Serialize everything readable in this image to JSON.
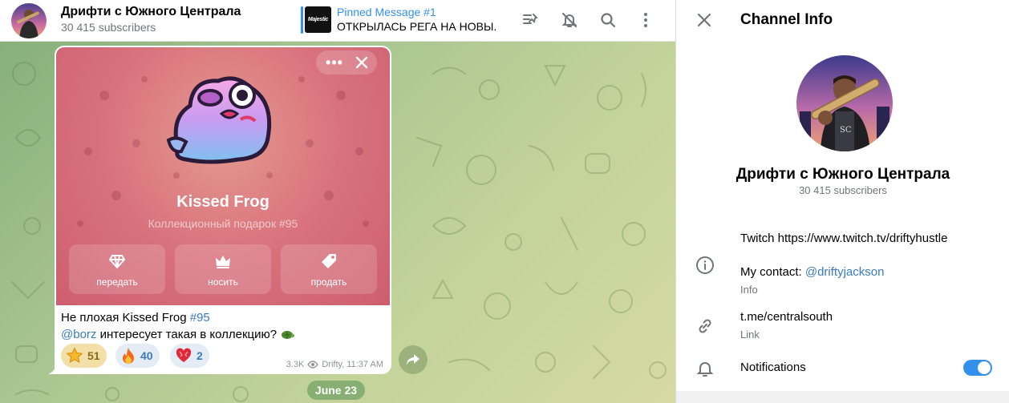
{
  "chat": {
    "title": "Дрифти с Южного Централа",
    "subscribers": "30 415 subscribers",
    "pinned": {
      "label": "Pinned Message #1",
      "text": "ОТКРЫЛАСЬ РЕГА НА НОВЫ...",
      "thumb_text": "Majestic"
    },
    "header_icons": [
      "pinned-list-icon",
      "mute-bell-icon",
      "search-icon",
      "more-vertical-icon"
    ]
  },
  "message": {
    "gift": {
      "name": "Kissed Frog",
      "subtitle": "Коллекционный подарок #95",
      "actions": [
        {
          "label": "передать",
          "icon": "gem-icon"
        },
        {
          "label": "носить",
          "icon": "crown-icon"
        },
        {
          "label": "продать",
          "icon": "tag-icon"
        }
      ],
      "more_label": "•••"
    },
    "text_line1_prefix": "Не плохая Kissed Frog ",
    "text_line1_tag": "#95",
    "text_line2_mention": "@borz",
    "text_line2_rest": " интересует такая в коллекцию? ",
    "reactions": [
      {
        "emoji": "star",
        "count": "51",
        "selected": true
      },
      {
        "emoji": "fire",
        "count": "40",
        "selected": false
      },
      {
        "emoji": "heart",
        "count": "2",
        "selected": false
      }
    ],
    "views": "3.3K",
    "author_time": "Drifty, 11:37 AM"
  },
  "date_pill": "June 23",
  "panel": {
    "title": "Channel Info",
    "name": "Дрифти с Южного Централа",
    "subscribers": "30 415 subscribers",
    "info_line1": "Twitch https://www.twitch.tv/driftyhustle",
    "info_line2_prefix": "My contact: ",
    "info_line2_link": "@driftyjackson",
    "info_label": "Info",
    "link_value": "t.me/centralsouth",
    "link_label": "Link",
    "notifications_label": "Notifications",
    "notifications_on": true
  },
  "colors": {
    "accent": "#3390ec",
    "link": "#3a7bbf",
    "gift_bg": "#d9727d"
  }
}
